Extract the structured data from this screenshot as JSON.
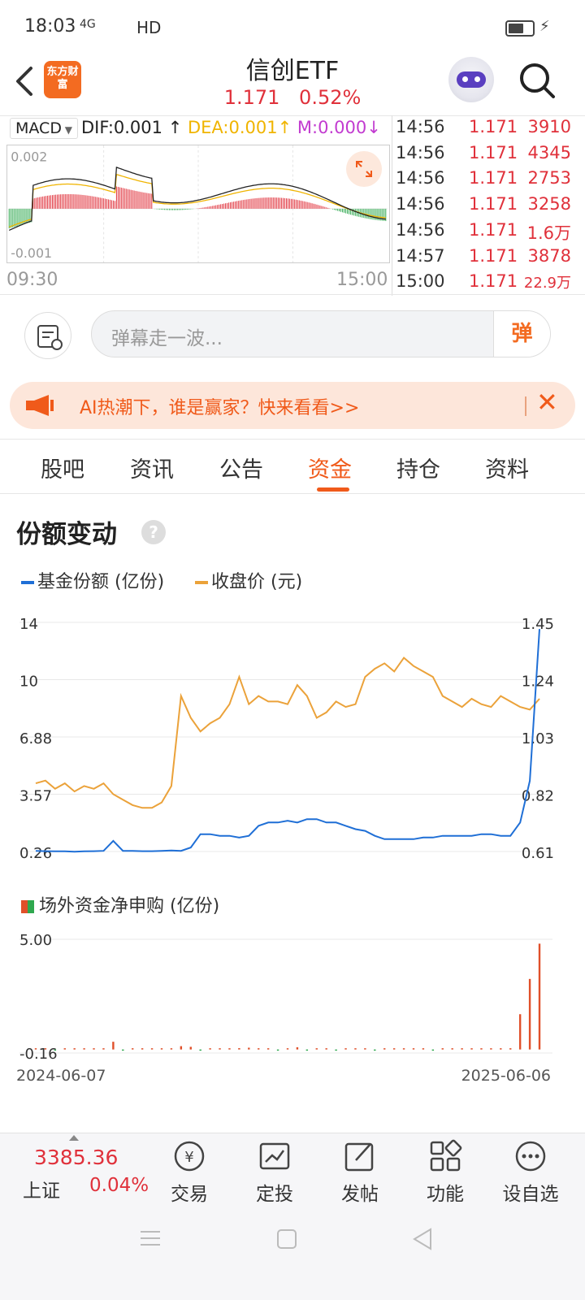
{
  "status_bar": {
    "time": "18:03",
    "network": "4G",
    "hd": "HD"
  },
  "header": {
    "logo": "东方财富",
    "title": "信创ETF",
    "price": "1.171",
    "change_pct": "0.52%"
  },
  "macd": {
    "selector": "MACD",
    "dif": "DIF:0.001",
    "dea": "DEA:0.001",
    "m": "M:0.000",
    "y_top": "0.002",
    "y_bottom": "-0.001",
    "time_open": "09:30",
    "time_close": "15:00"
  },
  "trades": [
    {
      "time": "14:56",
      "price": "1.171",
      "volume": "3910"
    },
    {
      "time": "14:56",
      "price": "1.171",
      "volume": "4345"
    },
    {
      "time": "14:56",
      "price": "1.171",
      "volume": "2753"
    },
    {
      "time": "14:56",
      "price": "1.171",
      "volume": "3258"
    },
    {
      "time": "14:56",
      "price": "1.171",
      "volume": "1.6万"
    },
    {
      "time": "14:57",
      "price": "1.171",
      "volume": "3878"
    },
    {
      "time": "15:00",
      "price": "1.171",
      "volume": "22.9万"
    }
  ],
  "danmu": {
    "placeholder": "弹幕走一波...",
    "send": "弹"
  },
  "banner": {
    "text": "AI热潮下，谁是赢家？快来看看>>"
  },
  "tabs": [
    "股吧",
    "资讯",
    "公告",
    "资金",
    "持仓",
    "资料"
  ],
  "active_tab": "资金",
  "section": {
    "title": "份额变动",
    "help": "?",
    "legend_share": "基金份额 (亿份)",
    "legend_close": "收盘价 (元)",
    "legend_flow": "场外资金净申购 (亿份)"
  },
  "colors": {
    "red": "#e0313b",
    "orange": "#f05a1a",
    "share_line": "#1f6fd6",
    "price_line": "#eba23a",
    "buy_bar": "#e0502a",
    "sell_bar": "#2fa84f"
  },
  "chart_data": [
    {
      "type": "line",
      "left_axis_ticks": [
        "14",
        "10",
        "6.88",
        "3.57",
        "0.26"
      ],
      "right_axis_ticks": [
        "1.45",
        "1.24",
        "1.03",
        "0.82",
        "0.61"
      ],
      "ylim_left": [
        0.26,
        14
      ],
      "ylim_right": [
        0.61,
        1.45
      ],
      "xlabel_start": "2024-06-07",
      "xlabel_end": "2025-06-06",
      "series": [
        {
          "name": "基金份额 (亿份)",
          "axis": "left",
          "values": [
            0.3,
            0.28,
            0.27,
            0.27,
            0.25,
            0.27,
            0.28,
            0.3,
            0.9,
            0.3,
            0.3,
            0.28,
            0.28,
            0.3,
            0.32,
            0.3,
            0.5,
            1.3,
            1.3,
            1.2,
            1.2,
            1.1,
            1.2,
            1.8,
            2.0,
            2.0,
            2.1,
            2.0,
            2.2,
            2.2,
            2.0,
            2.0,
            1.8,
            1.6,
            1.5,
            1.2,
            1.0,
            1.0,
            1.0,
            1.0,
            1.1,
            1.1,
            1.2,
            1.2,
            1.2,
            1.2,
            1.3,
            1.3,
            1.2,
            1.2,
            2.0,
            4.5,
            13.6
          ]
        },
        {
          "name": "收盘价 (元)",
          "axis": "right",
          "values": [
            0.86,
            0.87,
            0.84,
            0.86,
            0.83,
            0.85,
            0.84,
            0.86,
            0.82,
            0.8,
            0.78,
            0.77,
            0.77,
            0.79,
            0.85,
            1.18,
            1.1,
            1.05,
            1.08,
            1.1,
            1.15,
            1.25,
            1.15,
            1.18,
            1.16,
            1.16,
            1.15,
            1.22,
            1.18,
            1.1,
            1.12,
            1.16,
            1.14,
            1.15,
            1.25,
            1.28,
            1.3,
            1.27,
            1.32,
            1.29,
            1.27,
            1.25,
            1.18,
            1.16,
            1.14,
            1.17,
            1.15,
            1.14,
            1.18,
            1.16,
            1.14,
            1.13,
            1.17
          ]
        }
      ]
    },
    {
      "type": "bar",
      "title": "场外资金净申购 (亿份)",
      "y_ticks": [
        "5.00",
        "-0.16"
      ],
      "ylim": [
        -0.16,
        5.0
      ],
      "values": [
        0.0,
        0.01,
        -0.01,
        0.0,
        0.01,
        0.0,
        0.02,
        0.0,
        0.35,
        -0.05,
        0.0,
        0.01,
        0.0,
        0.0,
        0.05,
        0.15,
        0.12,
        -0.02,
        0.04,
        0.03,
        0.0,
        0.06,
        0.08,
        0.02,
        0.03,
        -0.02,
        0.04,
        0.1,
        -0.03,
        0.02,
        0.01,
        -0.04,
        0.02,
        0.05,
        0.03,
        -0.02,
        0.01,
        0.0,
        0.0,
        0.02,
        0.0,
        -0.01,
        0.0,
        0.01,
        0.03,
        0.0,
        0.0,
        0.0,
        0.01,
        0.05,
        1.6,
        3.2,
        4.8
      ]
    }
  ]
}
